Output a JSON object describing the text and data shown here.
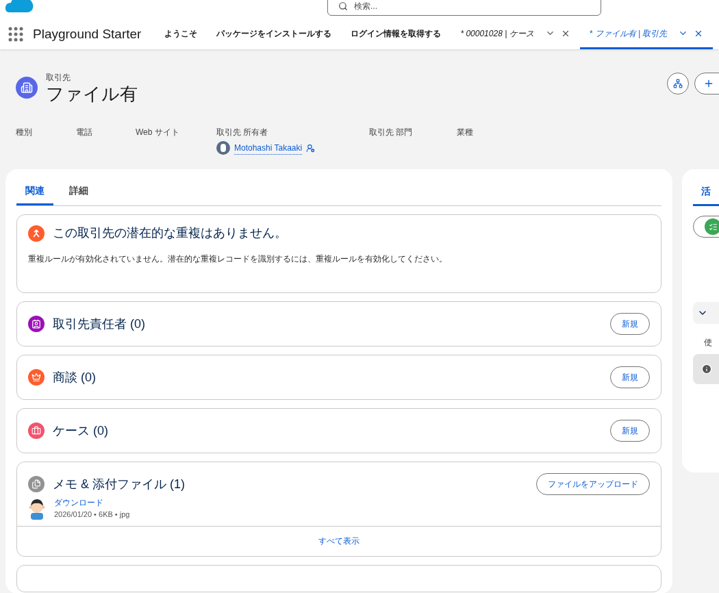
{
  "search": {
    "placeholder": "検索..."
  },
  "app": {
    "name": "Playground Starter"
  },
  "tabs": [
    {
      "label": "ようこそ",
      "kind": "nav",
      "selected": false
    },
    {
      "label": "パッケージをインストールする",
      "kind": "nav",
      "selected": false
    },
    {
      "label": "ログイン情報を取得する",
      "kind": "nav",
      "selected": false
    },
    {
      "label": "* 00001028 | ケース",
      "kind": "record",
      "selected": false
    },
    {
      "label": "* ファイル有 | 取引先",
      "kind": "record",
      "selected": true
    }
  ],
  "record": {
    "object": "取引先",
    "name": "ファイル有"
  },
  "fields": [
    {
      "label": "種別"
    },
    {
      "label": "電話"
    },
    {
      "label": "Web サイト"
    },
    {
      "label": "取引先 所有者",
      "value": "Motohashi Takaaki"
    },
    {
      "label": "取引先 部門"
    },
    {
      "label": "業種"
    }
  ],
  "detail_tabs": [
    {
      "label": "関連",
      "selected": true
    },
    {
      "label": "詳細",
      "selected": false
    }
  ],
  "duplicate": {
    "title": "この取引先の潜在的な重複はありません。",
    "message": "重複ルールが有効化されていません。潜在的な重複レコードを識別するには、重複ルールを有効化してください。"
  },
  "related": [
    {
      "kind": "contact",
      "title": "取引先責任者 (0)",
      "button": "新規",
      "color": "#9c10b9"
    },
    {
      "kind": "opportunity",
      "title": "商談 (0)",
      "button": "新規",
      "color": "#ff5d2d"
    },
    {
      "kind": "case",
      "title": "ケース (0)",
      "button": "新規",
      "color": "#f2536d"
    },
    {
      "kind": "files",
      "title": "メモ & 添付ファイル (1)",
      "button": "ファイルをアップロード",
      "color": "#939393",
      "files": [
        {
          "name": "ダウンロード",
          "meta": "2026/01/20 • 6KB • jpg"
        }
      ],
      "footer": "すべて表示"
    }
  ],
  "activity": {
    "tab": "活",
    "selected": true,
    "note": "使"
  }
}
